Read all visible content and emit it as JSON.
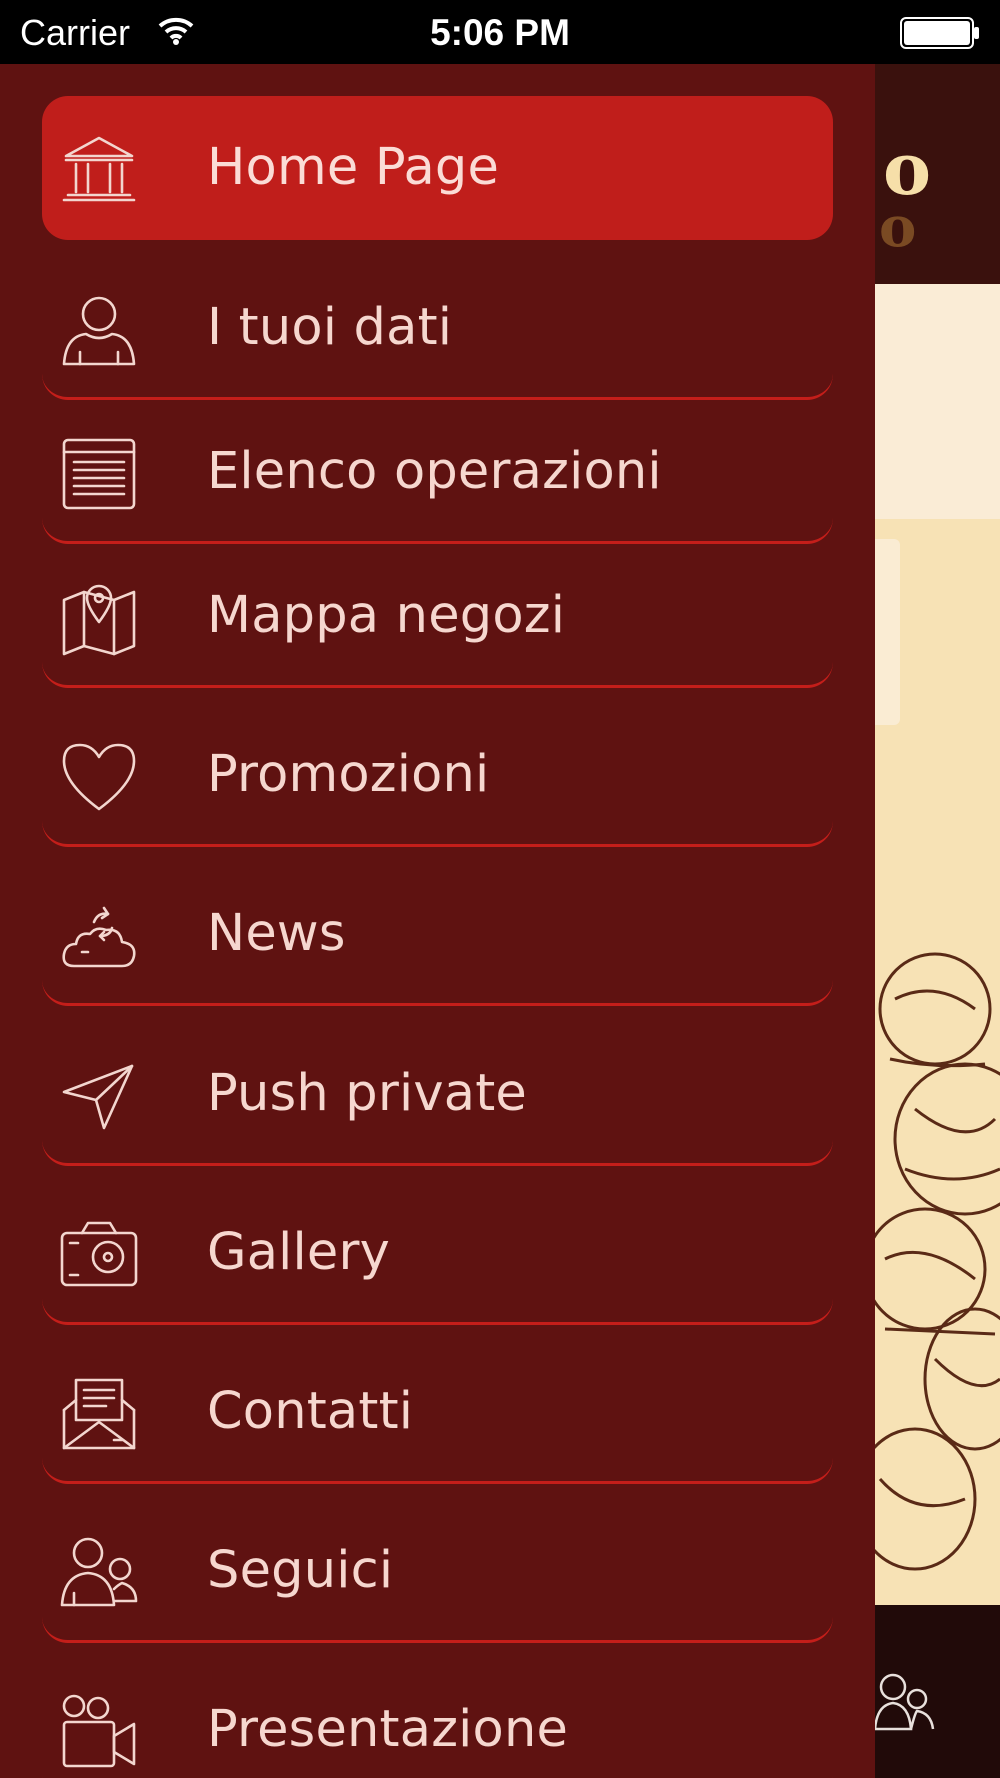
{
  "status_bar": {
    "carrier": "Carrier",
    "time": "5:06 PM"
  },
  "menu": {
    "items": [
      {
        "label": "Home Page",
        "icon": "temple-icon",
        "active": true
      },
      {
        "label": "I tuoi dati",
        "icon": "user-icon",
        "active": false
      },
      {
        "label": "Elenco operazioni",
        "icon": "list-document-icon",
        "active": false
      },
      {
        "label": "Mappa negozi",
        "icon": "map-pin-icon",
        "active": false
      },
      {
        "label": "Promozioni",
        "icon": "heart-icon",
        "active": false
      },
      {
        "label": "News",
        "icon": "cloud-sync-icon",
        "active": false
      },
      {
        "label": "Push private",
        "icon": "paper-plane-icon",
        "active": false
      },
      {
        "label": "Gallery",
        "icon": "camera-icon",
        "active": false
      },
      {
        "label": "Contatti",
        "icon": "envelope-icon",
        "active": false
      },
      {
        "label": "Seguici",
        "icon": "users-icon",
        "active": false
      },
      {
        "label": "Presentazione",
        "icon": "video-camera-icon",
        "active": false
      }
    ]
  },
  "colors": {
    "drawer_bg": "#5f1211",
    "active_item": "#c01e1b",
    "item_border": "#c41e1a",
    "text": "#f6d7cf"
  }
}
